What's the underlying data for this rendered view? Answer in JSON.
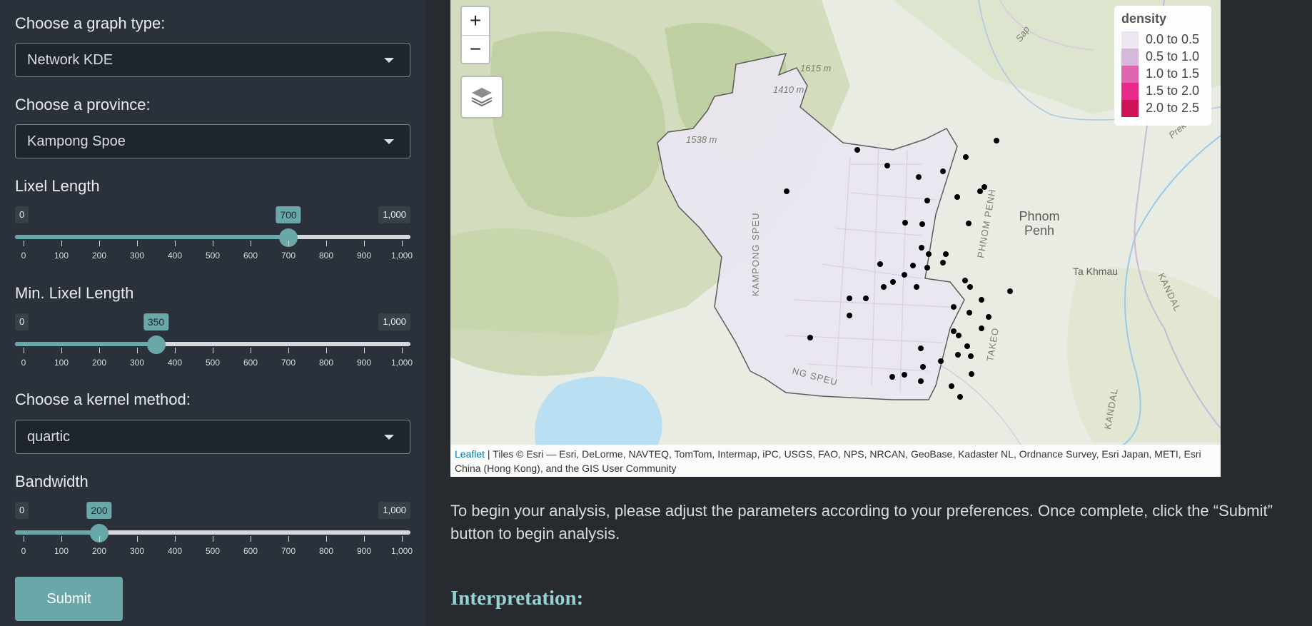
{
  "sidebar": {
    "graph_type": {
      "label": "Choose a graph type:",
      "value": "Network KDE"
    },
    "province": {
      "label": "Choose a province:",
      "value": "Kampong Spoe"
    },
    "lixel_length": {
      "label": "Lixel Length",
      "min_label": "0",
      "max_label": "1,000",
      "value_label": "700",
      "value": 700,
      "min": 0,
      "max": 1000
    },
    "min_lixel_length": {
      "label": "Min. Lixel Length",
      "min_label": "0",
      "max_label": "1,000",
      "value_label": "350",
      "value": 350,
      "min": 0,
      "max": 1000
    },
    "kernel": {
      "label": "Choose a kernel method:",
      "value": "quartic"
    },
    "bandwidth": {
      "label": "Bandwidth",
      "min_label": "0",
      "max_label": "1,000",
      "value_label": "200",
      "value": 200,
      "min": 0,
      "max": 1000
    },
    "tick_labels": [
      "0",
      "100",
      "200",
      "300",
      "400",
      "500",
      "600",
      "700",
      "800",
      "900",
      "1,000"
    ],
    "submit_label": "Submit"
  },
  "map": {
    "zoom_in": "+",
    "zoom_out": "−",
    "legend": {
      "title": "density",
      "items": [
        {
          "label": "0.0 to 0.5",
          "color": "#ece7f2"
        },
        {
          "label": "0.5 to 1.0",
          "color": "#d4b9da"
        },
        {
          "label": "1.0 to 1.5",
          "color": "#df65b0"
        },
        {
          "label": "1.5 to 2.0",
          "color": "#e7298a"
        },
        {
          "label": "2.0 to 2.5",
          "color": "#ce1256"
        }
      ]
    },
    "labels": {
      "elev1": "1615 m",
      "elev2": "1410 m",
      "elev3": "1538 m",
      "phnom_penh": "Phnom\nPenh",
      "ta_khmau": "Ta Khmau",
      "kampong_speu": "KAMPONG SPEU",
      "phnom_penh_vertical": "PHNOM PENH",
      "takeo": "TAKEO",
      "kandal": "KANDAL",
      "kandal2": "KANDAL",
      "speu": "NG SPEU",
      "sap": "Sap",
      "prek": "Prek"
    },
    "attribution": {
      "link": "Leaflet",
      "text": " | Tiles © Esri — Esri, DeLorme, NAVTEQ, TomTom, Intermap, iPC, USGS, FAO, NPS, NRCAN, GeoBase, Kadaster NL, Ordnance Survey, Esri Japan, METI, Esri China (Hong Kong), and the GIS User Community"
    }
  },
  "intro_text": "To begin your analysis, please adjust the parameters according to your preferences. Once complete, click the “Submit” button to begin analysis.",
  "interpretation_heading": "Interpretation:",
  "colors": {
    "accent": "#6aa7a9",
    "background": "#272b30",
    "sidebar": "#2b313a"
  }
}
